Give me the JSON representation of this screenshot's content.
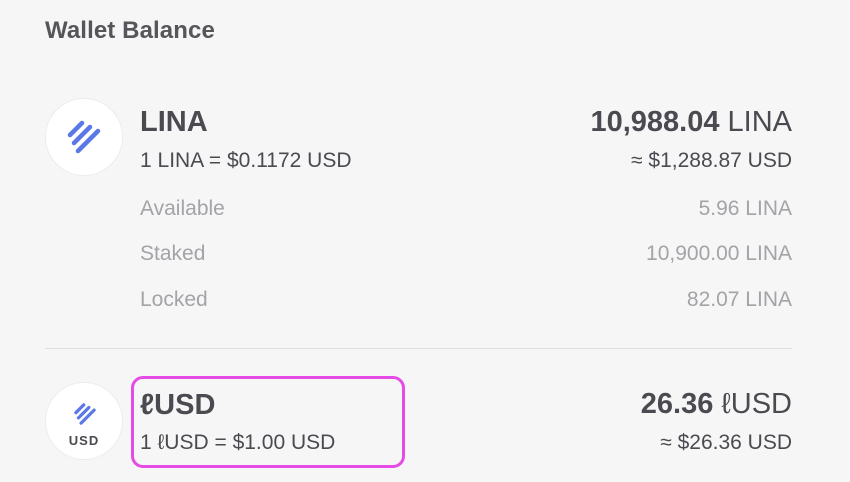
{
  "header": {
    "title": "Wallet Balance"
  },
  "tokens": [
    {
      "name": "LINA",
      "rate": "1 LINA = $0.1172 USD",
      "balance_amount": "10,988.04",
      "balance_unit": " LINA",
      "usd_value": "≈ $1,288.87 USD",
      "icon": "linear-logo-icon",
      "details": [
        {
          "label": "Available",
          "value": "5.96 LINA"
        },
        {
          "label": "Staked",
          "value": "10,900.00 LINA"
        },
        {
          "label": "Locked",
          "value": "82.07 LINA"
        }
      ]
    },
    {
      "name": "ℓUSD",
      "rate": "1 ℓUSD = $1.00 USD",
      "balance_amount": "26.36",
      "balance_unit": " ℓUSD",
      "usd_value": "≈ $26.36 USD",
      "icon": "lusd-logo-icon",
      "icon_label": "USD"
    }
  ],
  "colors": {
    "accent": "#5a78e6",
    "highlight": "#e64be6",
    "text": "#4a4a50",
    "muted": "#a3a3a8",
    "background": "#f6f6f6"
  }
}
